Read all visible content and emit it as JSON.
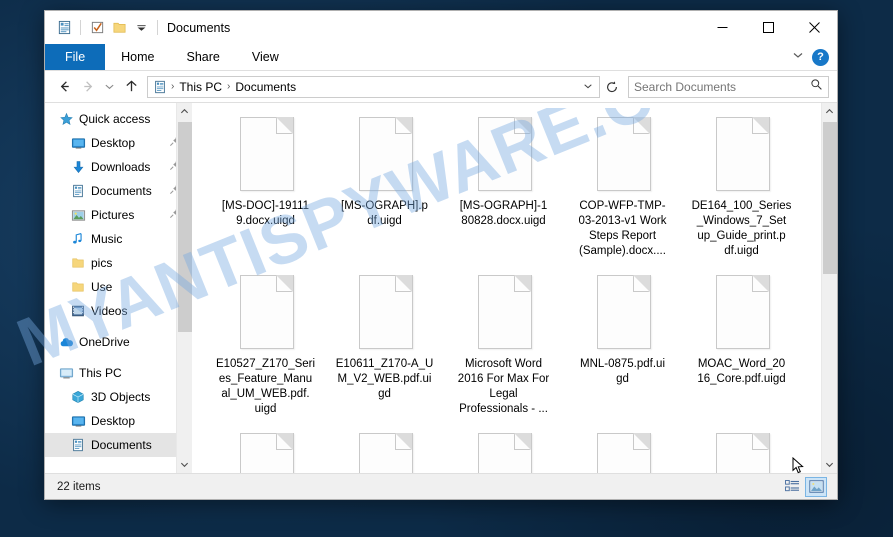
{
  "watermark": {
    "text": "MYANTISPYWARE.COM"
  },
  "window": {
    "title": "Documents",
    "quick_access": [
      {
        "name": "properties-icon",
        "label": "Properties"
      },
      {
        "name": "new-folder-icon",
        "label": "New folder"
      },
      {
        "name": "folder-icon",
        "label": "Folder"
      },
      {
        "name": "customize-dropdown-icon",
        "label": "Customize Quick Access Toolbar"
      }
    ],
    "controls": {
      "minimize": "—",
      "maximize": "☐",
      "close": "✕"
    }
  },
  "ribbon": {
    "tabs": [
      {
        "label": "File",
        "active": true
      },
      {
        "label": "Home",
        "active": false
      },
      {
        "label": "Share",
        "active": false
      },
      {
        "label": "View",
        "active": false
      }
    ],
    "expand_label": "⌄",
    "help_label": "?"
  },
  "navigation": {
    "back": "←",
    "forward": "→",
    "recent": "⌄",
    "up": "↑",
    "refresh": "↻",
    "breadcrumb": [
      "This PC",
      "Documents"
    ],
    "separator": "›"
  },
  "search": {
    "placeholder": "Search Documents",
    "value": "",
    "icon": "search-icon"
  },
  "sidebar": {
    "items": [
      {
        "label": "Quick access",
        "icon": "star-icon",
        "indent": false,
        "pinned": false,
        "selected": false
      },
      {
        "label": "Desktop",
        "icon": "desktop-icon",
        "indent": true,
        "pinned": true,
        "selected": false
      },
      {
        "label": "Downloads",
        "icon": "download-icon",
        "indent": true,
        "pinned": true,
        "selected": false
      },
      {
        "label": "Documents",
        "icon": "document-icon",
        "indent": true,
        "pinned": true,
        "selected": false
      },
      {
        "label": "Pictures",
        "icon": "pictures-icon",
        "indent": true,
        "pinned": true,
        "selected": false
      },
      {
        "label": "Music",
        "icon": "music-icon",
        "indent": true,
        "pinned": false,
        "selected": false
      },
      {
        "label": "pics",
        "icon": "folder-icon",
        "indent": true,
        "pinned": false,
        "selected": false
      },
      {
        "label": "Use",
        "icon": "folder-icon",
        "indent": true,
        "pinned": false,
        "selected": false
      },
      {
        "label": "Videos",
        "icon": "videos-icon",
        "indent": true,
        "pinned": false,
        "selected": false
      },
      {
        "label": "OneDrive",
        "icon": "cloud-icon",
        "indent": false,
        "pinned": false,
        "selected": false
      },
      {
        "label": "This PC",
        "icon": "pc-icon",
        "indent": false,
        "pinned": false,
        "selected": false
      },
      {
        "label": "3D Objects",
        "icon": "3d-objects-icon",
        "indent": true,
        "pinned": false,
        "selected": false
      },
      {
        "label": "Desktop",
        "icon": "desktop-icon",
        "indent": true,
        "pinned": false,
        "selected": false
      },
      {
        "label": "Documents",
        "icon": "document-icon",
        "indent": true,
        "pinned": false,
        "selected": true
      }
    ]
  },
  "files": [
    {
      "name": "[MS-DOC]-19111\n9.docx.uigd",
      "icon": "generic-file-icon"
    },
    {
      "name": "[MS-OGRAPH].p\ndf.uigd",
      "icon": "generic-file-icon"
    },
    {
      "name": "[MS-OGRAPH]-1\n80828.docx.uigd",
      "icon": "generic-file-icon"
    },
    {
      "name": "COP-WFP-TMP-\n03-2013-v1 Work\nSteps Report\n(Sample).docx....",
      "icon": "generic-file-icon"
    },
    {
      "name": "DE164_100_Series\n_Windows_7_Set\nup_Guide_print.p\ndf.uigd",
      "icon": "generic-file-icon"
    },
    {
      "name": "E10527_Z170_Seri\nes_Feature_Manu\nal_UM_WEB.pdf.\nuigd",
      "icon": "generic-file-icon"
    },
    {
      "name": "E10611_Z170-A_U\nM_V2_WEB.pdf.ui\ngd",
      "icon": "generic-file-icon"
    },
    {
      "name": "Microsoft Word\n2016 For Max For\nLegal\nProfessionals - ...",
      "icon": "generic-file-icon"
    },
    {
      "name": "MNL-0875.pdf.ui\ngd",
      "icon": "generic-file-icon"
    },
    {
      "name": "MOAC_Word_20\n16_Core.pdf.uigd",
      "icon": "generic-file-icon"
    },
    {
      "name": "",
      "icon": "generic-file-icon"
    },
    {
      "name": "",
      "icon": "generic-file-icon"
    },
    {
      "name": "",
      "icon": "generic-file-icon"
    },
    {
      "name": "",
      "icon": "generic-file-icon"
    },
    {
      "name": "",
      "icon": "generic-file-icon"
    }
  ],
  "statusbar": {
    "item_count": "22 items",
    "views": [
      {
        "name": "details-view-button",
        "active": false
      },
      {
        "name": "large-icons-view-button",
        "active": true
      }
    ]
  },
  "colors": {
    "accent": "#0d6cb9",
    "desktop": "#0d2b47",
    "selection": "#cce4f7",
    "watermark": "#78aae1"
  }
}
